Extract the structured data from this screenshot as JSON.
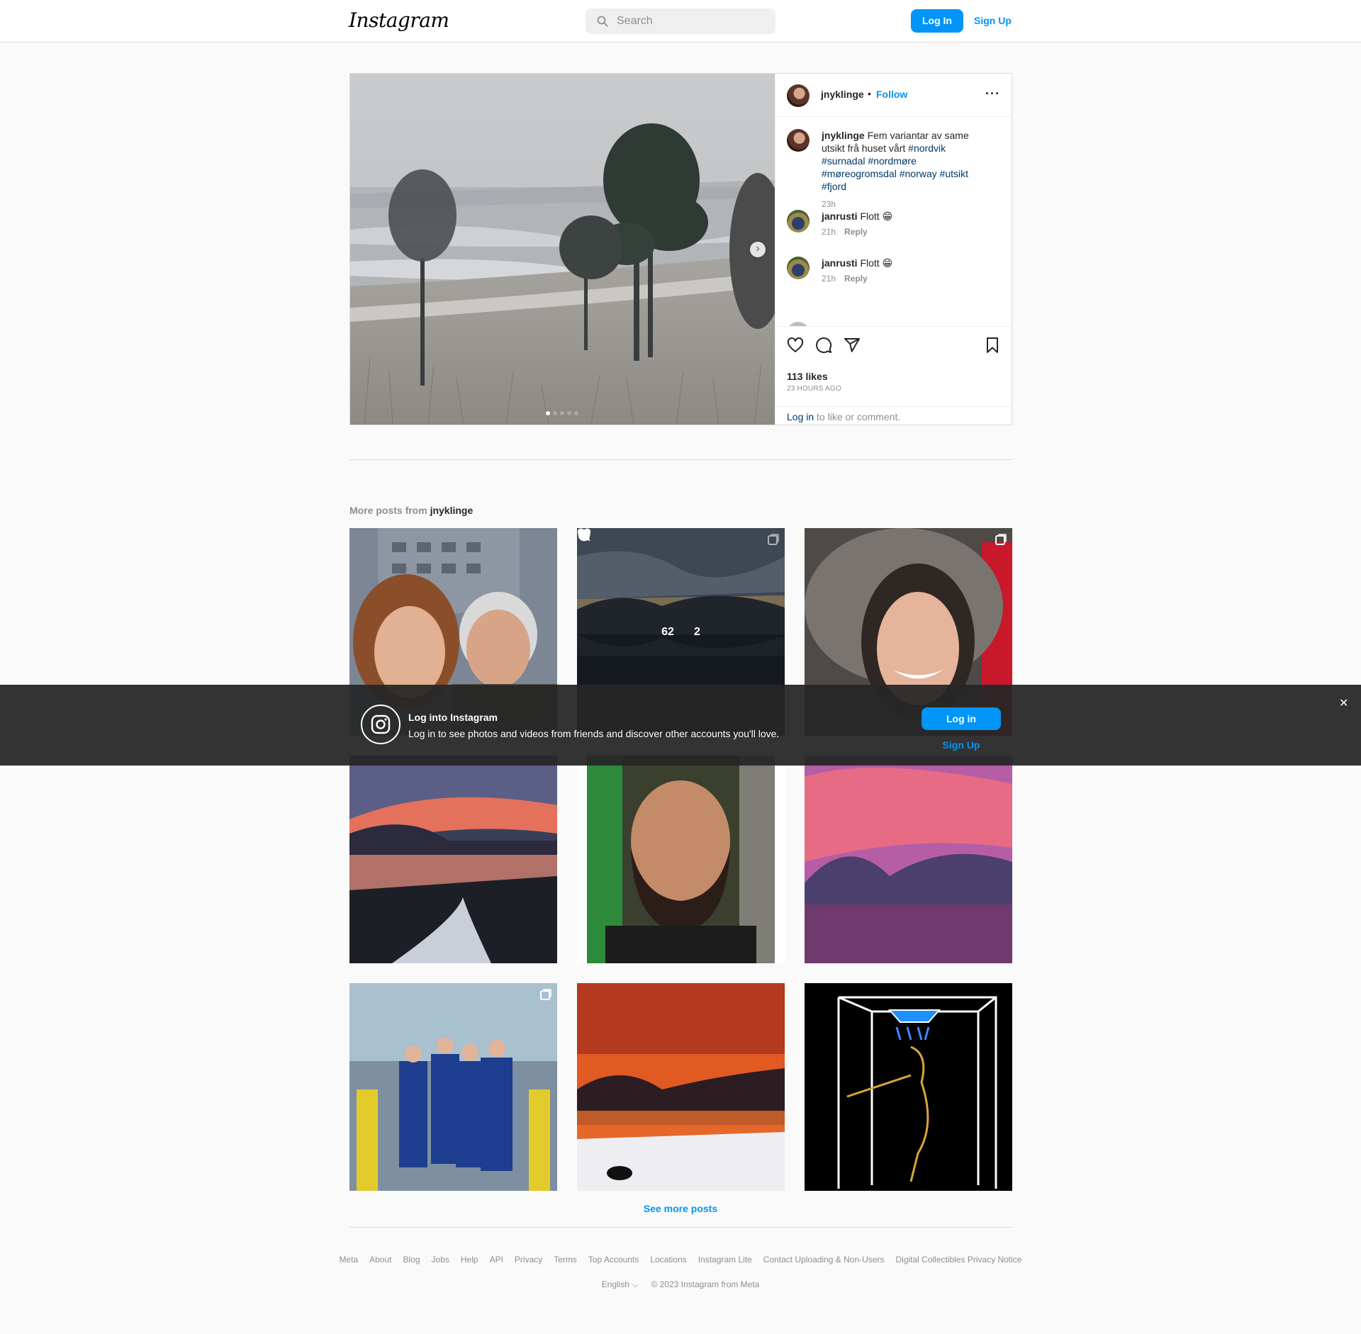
{
  "nav": {
    "logo": "Instagram",
    "search_placeholder": "Search",
    "login_label": "Log In",
    "signup_label": "Sign Up"
  },
  "post": {
    "username": "jnyklinge",
    "separator": "•",
    "follow_label": "Follow",
    "more_icon": "more-horizontal-icon",
    "caption": {
      "username": "jnyklinge",
      "text": "Fem variantar av same utsikt frå huset vårt",
      "hashtags": [
        "#nordvik",
        "#surnadal",
        "#nordmøre",
        "#møreogromsdal",
        "#norway",
        "#utsikt",
        "#fjord"
      ],
      "time": "23h"
    },
    "comments": [
      {
        "username": "janrusti",
        "text": "Flott 😁",
        "time": "21h",
        "reply_label": "Reply"
      },
      {
        "username": "janrusti",
        "text": "Flott 😁",
        "time": "21h",
        "reply_label": "Reply"
      }
    ],
    "likes": "113 likes",
    "posted": "23 HOURS AGO",
    "login_link": "Log in",
    "login_suffix": " to like or comment.",
    "carousel_total": 5,
    "carousel_index": 1
  },
  "more_posts": {
    "prefix": "More posts from ",
    "username": "jnyklinge",
    "hover_stats": {
      "likes": "62",
      "comments": "2"
    },
    "see_more_label": "See more posts"
  },
  "banner": {
    "title": "Log into Instagram",
    "subtitle": "Log in to see photos and videos from friends and discover other accounts you'll love.",
    "login_label": "Log in",
    "signup_label": "Sign Up",
    "close_label": "✕"
  },
  "footer": {
    "links": [
      "Meta",
      "About",
      "Blog",
      "Jobs",
      "Help",
      "API",
      "Privacy",
      "Terms",
      "Top Accounts",
      "Locations",
      "Instagram Lite",
      "Contact Uploading & Non-Users",
      "Digital Collectibles Privacy Notice"
    ],
    "language": "English",
    "copyright": "© 2023 Instagram from Meta"
  },
  "colors": {
    "accent": "#0095f6",
    "hashtag": "#00376b",
    "muted": "#8e8e8e",
    "border": "#dbdbdb"
  }
}
